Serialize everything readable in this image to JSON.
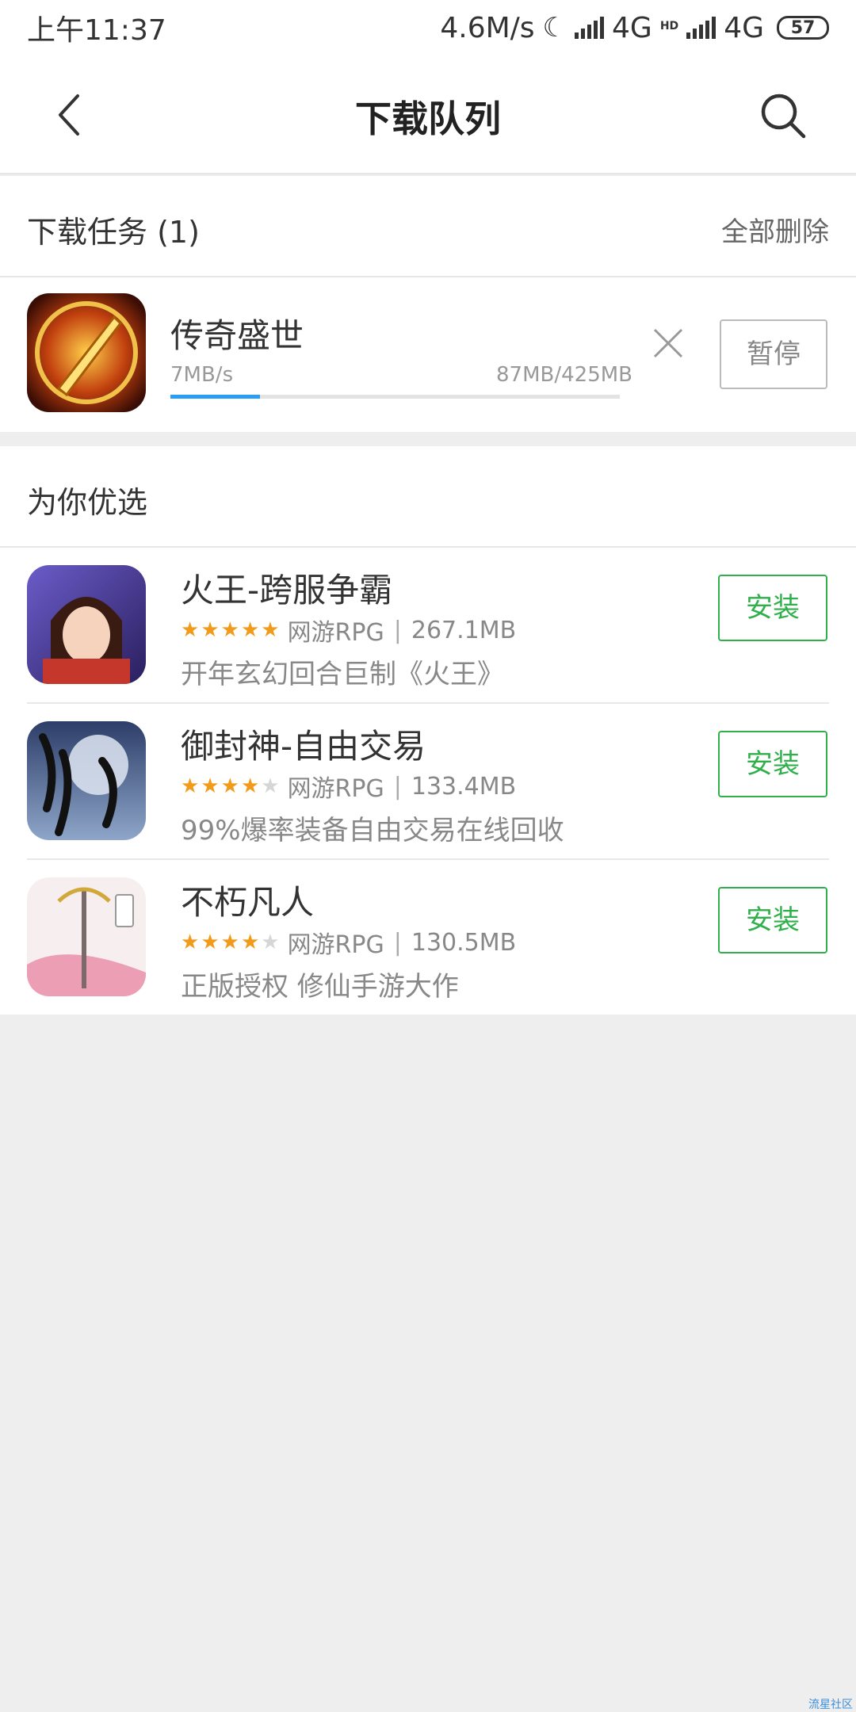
{
  "status_bar": {
    "time": "上午11:37",
    "net_speed": "4.6M/s",
    "network_1": "4G",
    "hd_badge": "HD",
    "network_2": "4G",
    "battery": "57"
  },
  "header": {
    "title": "下载队列",
    "back_icon": "chevron-left-icon",
    "search_icon": "search-icon"
  },
  "downloads": {
    "section_label": "下载任务 (1)",
    "delete_all_label": "全部删除",
    "item": {
      "name": "传奇盛世",
      "speed": "7MB/s",
      "size": "87MB/425MB",
      "progress": 0.2,
      "pause_label": "暂停"
    }
  },
  "recommend": {
    "section_label": "为你优选",
    "items": [
      {
        "name": "火王-跨服争霸",
        "rating": 5,
        "category": "网游RPG",
        "size": "267.1MB",
        "desc": "开年玄幻回合巨制《火王》",
        "install_label": "安装"
      },
      {
        "name": "御封神-自由交易",
        "rating": 4,
        "category": "网游RPG",
        "size": "133.4MB",
        "desc": "99%爆率装备自由交易在线回收",
        "install_label": "安装"
      },
      {
        "name": "不朽凡人",
        "rating": 4,
        "category": "网游RPG",
        "size": "130.5MB",
        "desc": "正版授权  修仙手游大作",
        "install_label": "安装"
      }
    ]
  },
  "colors": {
    "accent_green": "#2fb04a",
    "progress_blue": "#2a9df4",
    "star_orange": "#f29a1a"
  },
  "watermark": "流星社区"
}
